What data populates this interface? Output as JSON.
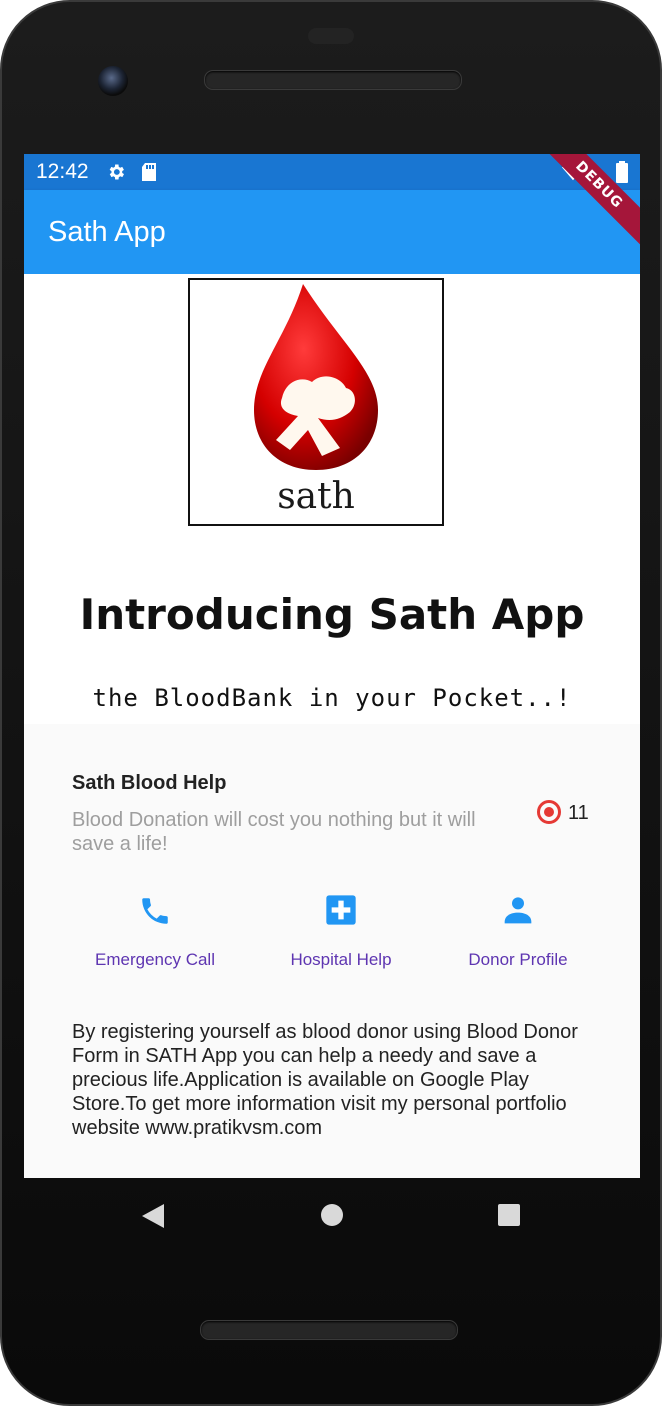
{
  "statusbar": {
    "time": "12:42",
    "icons": [
      "gear-icon",
      "sd-card-icon",
      "wifi-icon",
      "battery-icon"
    ]
  },
  "appbar": {
    "title": "Sath App",
    "debug_banner": "DEBUG",
    "color": "#2196f3"
  },
  "hero": {
    "logo_word": "sath",
    "headline": "Introducing Sath App",
    "tagline": "the BloodBank in your Pocket..!"
  },
  "card": {
    "title": "Sath Blood Help",
    "subtitle": "Blood Donation will cost you nothing but it will save a life!",
    "count": "11",
    "accent": "#e53935"
  },
  "actions": [
    {
      "label": "Emergency Call",
      "icon": "phone-icon"
    },
    {
      "label": "Hospital Help",
      "icon": "hospital-plus-icon"
    },
    {
      "label": "Donor Profile",
      "icon": "person-icon"
    }
  ],
  "description": "By registering yourself as blood donor using Blood Donor Form in SATH App you can help a needy and save a precious life.Application is available on Google Play Store.To get more information visit my personal portfolio website www.pratikvsm.com",
  "navbar": [
    "back-icon",
    "home-icon",
    "recents-icon"
  ]
}
